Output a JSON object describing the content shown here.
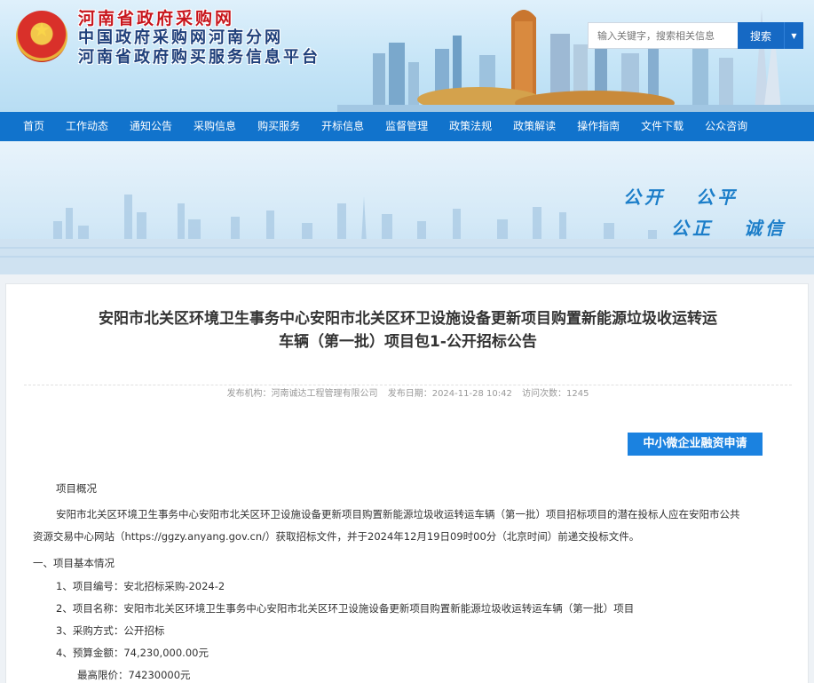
{
  "header": {
    "title_line1": "河南省政府采购网",
    "title_line2": "中国政府采购网河南分网",
    "title_line3": "河南省政府购买服务信息平台",
    "search_placeholder": "输入关键字，搜索相关信息",
    "search_button": "搜索"
  },
  "nav": {
    "items": [
      "首页",
      "工作动态",
      "通知公告",
      "采购信息",
      "购买服务",
      "开标信息",
      "监督管理",
      "政策法规",
      "政策解读",
      "操作指南",
      "文件下载",
      "公众咨询"
    ]
  },
  "banner": {
    "slogan1": "公开",
    "slogan2": "公平",
    "slogan3": "公正",
    "slogan4": "诚信"
  },
  "article": {
    "title_line1": "安阳市北关区环境卫生事务中心安阳市北关区环卫设施设备更新项目购置新能源垃圾收运转运",
    "title_line2": "车辆（第一批）项目包1-公开招标公告",
    "publisher": "发布机构：河南诚达工程管理有限公司",
    "date": "发布日期：2024-11-28 10:42",
    "visits": "访问次数：1245",
    "apply_button": "中小微企业融资申请",
    "overview_heading": "项目概况",
    "overview_line1": "安阳市北关区环境卫生事务中心安阳市北关区环卫设施设备更新项目购置新能源垃圾收运转运车辆（第一批）项目招标项目的潜在投标人应在安阳市公共",
    "overview_line2": "资源交易中心网站（https://ggzy.anyang.gov.cn/）获取招标文件，并于2024年12月19日09时00分（北京时间）前递交投标文件。",
    "section1": "一、项目基本情况",
    "item1": "1、项目编号：安北招标采购-2024-2",
    "item2": "2、项目名称：安阳市北关区环境卫生事务中心安阳市北关区环卫设施设备更新项目购置新能源垃圾收运转运车辆（第一批）项目",
    "item3": "3、采购方式：公开招标",
    "item4": "4、预算金额：74,230,000.00元",
    "item5": "最高限价：74230000元"
  }
}
